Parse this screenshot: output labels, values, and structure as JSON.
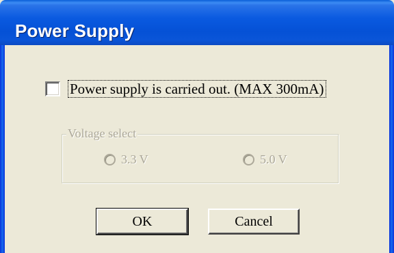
{
  "window": {
    "title": "Power Supply"
  },
  "power_checkbox": {
    "label": "Power supply is carried out. (MAX 300mA)",
    "checked": false
  },
  "voltage_group": {
    "legend": "Voltage select",
    "enabled": false,
    "options": [
      {
        "label": "3.3 V",
        "selected": false
      },
      {
        "label": "5.0 V",
        "selected": false
      }
    ]
  },
  "buttons": {
    "ok_label": "OK",
    "cancel_label": "Cancel"
  },
  "colors": {
    "titlebar": "#0551d6",
    "dialog_background": "#ece9d8",
    "disabled_text": "#aca899"
  }
}
